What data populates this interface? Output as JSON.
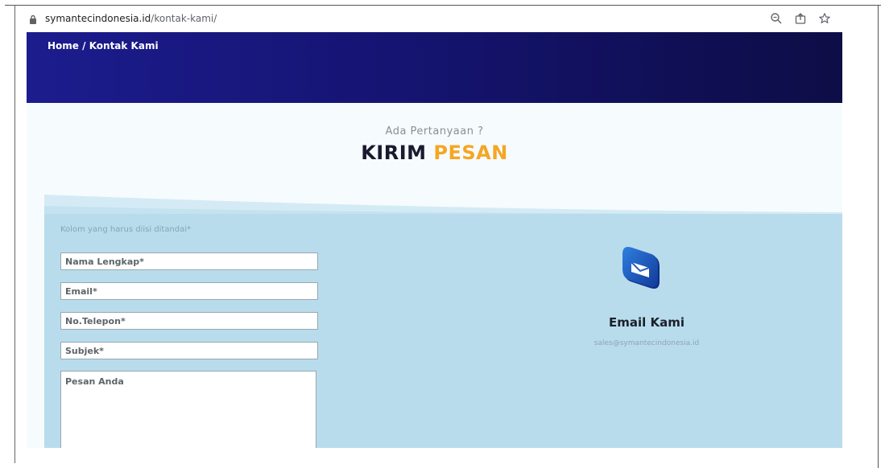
{
  "browser": {
    "url_domain": "symantecindonesia.id",
    "url_path": "/kontak-kami/",
    "icons": [
      "lock-icon",
      "zoom-icon",
      "share-icon",
      "bookmark-star-icon"
    ]
  },
  "hero": {
    "breadcrumb_home": "Home",
    "breadcrumb_sep": " / ",
    "breadcrumb_current": "Kontak Kami"
  },
  "intro": {
    "subtitle": "Ada Pertanyaan ?",
    "heading_part1": "KIRIM",
    "heading_part2": "PESAN"
  },
  "form": {
    "required_hint": "Kolom yang harus diisi ditandai*",
    "name_placeholder": "Nama Lengkap*",
    "email_placeholder": "Email*",
    "phone_placeholder": "No.Telepon*",
    "subject_placeholder": "Subjek*",
    "message_placeholder": "Pesan Anda"
  },
  "contact": {
    "icon": "mail-icon",
    "title": "Email Kami",
    "address": "sales@symantecindonesia.id"
  },
  "colors": {
    "hero_start": "#1c1c8e",
    "hero_end": "#0d0d47",
    "accent": "#f5a623",
    "panel": "#b8dcec"
  }
}
